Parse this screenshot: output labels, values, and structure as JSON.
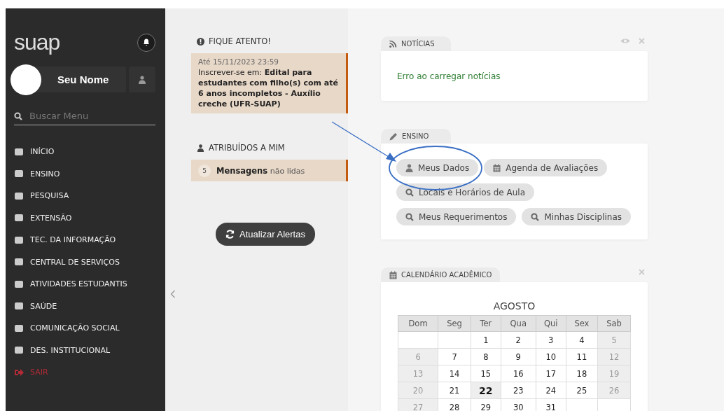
{
  "sidebar": {
    "logo": "suap",
    "user": {
      "name": "Seu Nome"
    },
    "search": {
      "placeholder": "Buscar Menu"
    },
    "menu": [
      {
        "label": "INÍCIO",
        "kind": "link"
      },
      {
        "label": "ENSINO",
        "kind": "link"
      },
      {
        "label": "PESQUISA",
        "kind": "link"
      },
      {
        "label": "EXTENSÃO",
        "kind": "link"
      },
      {
        "label": "TEC. DA INFORMAÇÃO",
        "kind": "link"
      },
      {
        "label": "CENTRAL DE SERVIÇOS",
        "kind": "link"
      },
      {
        "label": "ATIVIDADES ESTUDANTIS",
        "kind": "link"
      },
      {
        "label": "SAÚDE",
        "kind": "link"
      },
      {
        "label": "COMUNICAÇÃO SOCIAL",
        "kind": "link"
      },
      {
        "label": "DES. INSTITUCIONAL",
        "kind": "link"
      },
      {
        "label": "SAIR",
        "kind": "exit"
      }
    ]
  },
  "alerts": {
    "title": "FIQUE ATENTO!",
    "items": [
      {
        "date": "Até 15/11/2023 23:59",
        "text": "Inscrever-se em: **Edital para estudantes com filho(s) com até 6 anos incompletos - Auxílio creche (UFR-SUAP)**"
      }
    ]
  },
  "assigned": {
    "title": "ATRIBUÍDOS A MIM",
    "items": [
      {
        "count": "5",
        "label": "Mensagens",
        "suffix": "não lidas"
      }
    ]
  },
  "refresh_button": "Atualizar Alertas",
  "news": {
    "title": "NOTÍCIAS",
    "message": "Erro ao carregar notícias"
  },
  "ensino": {
    "title": "ENSINO",
    "links": [
      {
        "label": "Meus Dados",
        "kind": "user"
      },
      {
        "label": "Agenda de Avaliações",
        "kind": "calendar"
      },
      {
        "label": "Locais e Horários de Aula",
        "kind": "search"
      },
      {
        "label": "Meus Requerimentos",
        "kind": "search"
      },
      {
        "label": "Minhas Disciplinas",
        "kind": "search"
      }
    ]
  },
  "calendar": {
    "title": "CALENDÁRIO ACADÊMICO",
    "month": "AGOSTO",
    "weekdays": [
      "Dom",
      "Seg",
      "Ter",
      "Qua",
      "Qui",
      "Sex",
      "Sab"
    ],
    "weeks": [
      [
        {
          "kind": "blank"
        },
        {
          "kind": "blank"
        },
        {
          "day": "1",
          "today": false
        },
        {
          "day": "2",
          "today": false
        },
        {
          "day": "3",
          "today": false
        },
        {
          "day": "4",
          "today": false
        },
        {
          "day": "5",
          "today": false
        }
      ],
      [
        {
          "day": "6",
          "today": false
        },
        {
          "day": "7",
          "today": false
        },
        {
          "day": "8",
          "today": false
        },
        {
          "day": "9",
          "today": false
        },
        {
          "day": "10",
          "today": false
        },
        {
          "day": "11",
          "today": false
        },
        {
          "day": "12",
          "today": false
        }
      ],
      [
        {
          "day": "13",
          "today": false
        },
        {
          "day": "14",
          "today": false
        },
        {
          "day": "15",
          "today": false
        },
        {
          "day": "16",
          "today": false
        },
        {
          "day": "17",
          "today": false
        },
        {
          "day": "18",
          "today": false
        },
        {
          "day": "19",
          "today": false
        }
      ],
      [
        {
          "day": "20",
          "today": false
        },
        {
          "day": "21",
          "today": false
        },
        {
          "day": "22",
          "today": true
        },
        {
          "day": "23",
          "today": false
        },
        {
          "day": "24",
          "today": false
        },
        {
          "day": "25",
          "today": false
        },
        {
          "day": "26",
          "today": false
        }
      ],
      [
        {
          "day": "27",
          "today": false
        },
        {
          "day": "28",
          "today": false
        },
        {
          "day": "29",
          "today": false
        },
        {
          "day": "30",
          "today": false
        },
        {
          "day": "31",
          "today": false
        },
        {
          "kind": "blank"
        },
        {
          "kind": "blank"
        }
      ]
    ]
  }
}
